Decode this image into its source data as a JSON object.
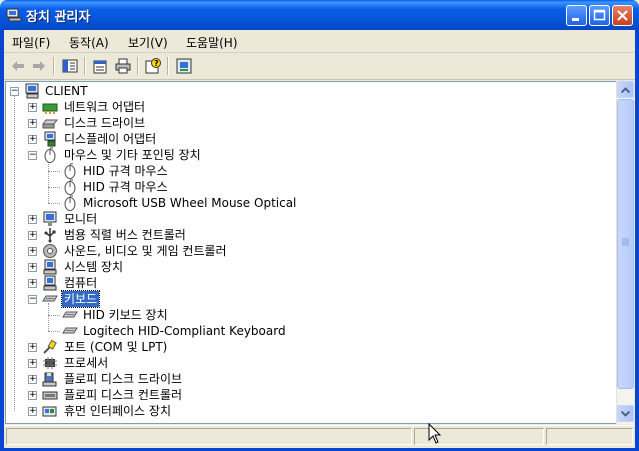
{
  "window": {
    "title": "장치 관리자"
  },
  "menu": [
    {
      "label": "파일(F)"
    },
    {
      "label": "동작(A)"
    },
    {
      "label": "보기(V)"
    },
    {
      "label": "도움말(H)"
    }
  ],
  "toolbar": {
    "icons": [
      "back-arrow-icon",
      "forward-arrow-icon",
      "console-tree-icon",
      "properties-icon",
      "print-icon",
      "help-icon",
      "computer-view-icon"
    ]
  },
  "tree": {
    "root": "CLIENT",
    "nodes": [
      {
        "label": "네트워크 어댑터",
        "level": 1,
        "state": "collapsed",
        "icon": "network-adapter-icon"
      },
      {
        "label": "디스크 드라이브",
        "level": 1,
        "state": "collapsed",
        "icon": "disk-drive-icon"
      },
      {
        "label": "디스플레이 어댑터",
        "level": 1,
        "state": "collapsed",
        "icon": "display-adapter-icon"
      },
      {
        "label": "마우스 및 기타 포인팅 장치",
        "level": 1,
        "state": "expanded",
        "icon": "mouse-icon"
      },
      {
        "label": "HID 규격 마우스",
        "level": 2,
        "icon": "mouse-icon"
      },
      {
        "label": "HID 규격 마우스",
        "level": 2,
        "icon": "mouse-icon"
      },
      {
        "label": "Microsoft USB Wheel Mouse Optical",
        "level": 2,
        "icon": "mouse-icon"
      },
      {
        "label": "모니터",
        "level": 1,
        "state": "collapsed",
        "icon": "monitor-icon"
      },
      {
        "label": "범용 직렬 버스 컨트롤러",
        "level": 1,
        "state": "collapsed",
        "icon": "usb-icon"
      },
      {
        "label": "사운드, 비디오 및 게임 컨트롤러",
        "level": 1,
        "state": "collapsed",
        "icon": "sound-icon"
      },
      {
        "label": "시스템 장치",
        "level": 1,
        "state": "collapsed",
        "icon": "system-device-icon"
      },
      {
        "label": "컴퓨터",
        "level": 1,
        "state": "collapsed",
        "icon": "computer-icon"
      },
      {
        "label": "키보드",
        "level": 1,
        "state": "expanded",
        "selected": true,
        "icon": "keyboard-icon"
      },
      {
        "label": "HID 키보드 장치",
        "level": 2,
        "icon": "keyboard-icon"
      },
      {
        "label": "Logitech HID-Compliant Keyboard",
        "level": 2,
        "icon": "keyboard-icon"
      },
      {
        "label": "포트 (COM 및 LPT)",
        "level": 1,
        "state": "collapsed",
        "icon": "port-icon"
      },
      {
        "label": "프로세서",
        "level": 1,
        "state": "collapsed",
        "icon": "processor-icon"
      },
      {
        "label": "플로피 디스크 드라이브",
        "level": 1,
        "state": "collapsed",
        "icon": "floppy-drive-icon"
      },
      {
        "label": "플로피 디스크 컨트롤러",
        "level": 1,
        "state": "collapsed",
        "icon": "floppy-controller-icon"
      },
      {
        "label": "휴먼 인터페이스 장치",
        "level": 1,
        "state": "collapsed",
        "icon": "hid-icon"
      }
    ]
  },
  "colors": {
    "titlebar": "#0a5ee8",
    "selection": "#316ac5"
  }
}
